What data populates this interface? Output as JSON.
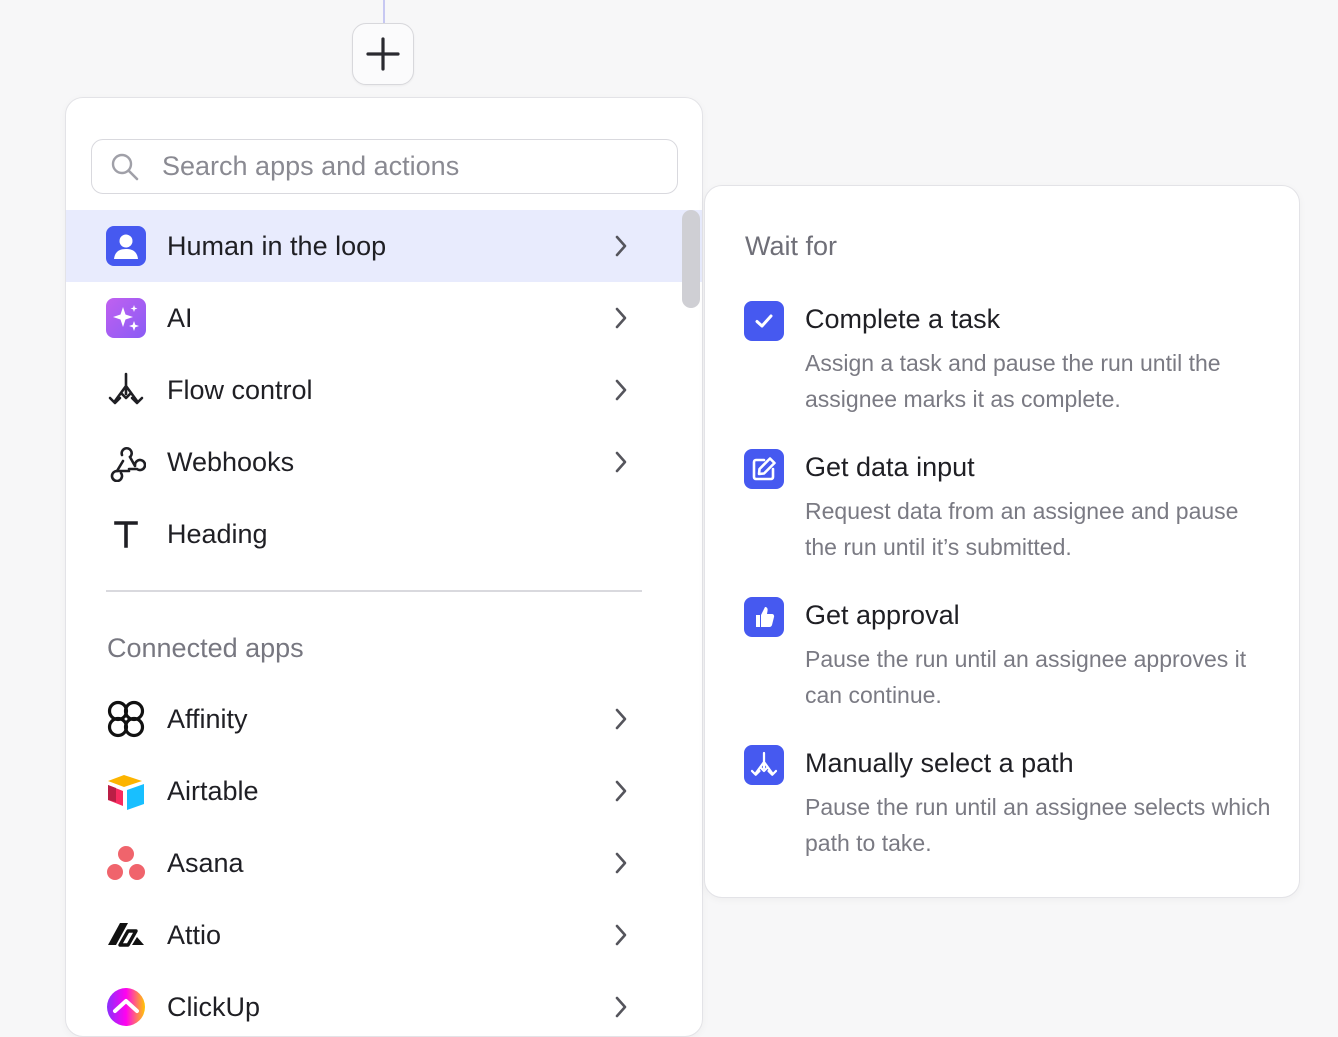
{
  "search": {
    "placeholder": "Search apps and actions"
  },
  "menu": {
    "items": [
      {
        "label": "Human in the loop",
        "icon": "person-icon",
        "active": true
      },
      {
        "label": "AI",
        "icon": "sparkles-icon"
      },
      {
        "label": "Flow control",
        "icon": "split-arrows-icon"
      },
      {
        "label": "Webhooks",
        "icon": "webhook-icon"
      },
      {
        "label": "Heading",
        "icon": "text-heading-icon"
      }
    ],
    "connected_label": "Connected apps",
    "apps": [
      {
        "label": "Affinity",
        "icon": "affinity-logo-icon"
      },
      {
        "label": "Airtable",
        "icon": "airtable-logo-icon"
      },
      {
        "label": "Asana",
        "icon": "asana-logo-icon"
      },
      {
        "label": "Attio",
        "icon": "attio-logo-icon"
      },
      {
        "label": "ClickUp",
        "icon": "clickup-logo-icon"
      }
    ]
  },
  "submenu": {
    "title": "Wait for",
    "options": [
      {
        "title": "Complete a task",
        "description": "Assign a task and pause the run until the assignee marks it as complete.",
        "icon": "checkbox-icon"
      },
      {
        "title": "Get data input",
        "description": "Request data from an assignee and pause the run until it’s submitted.",
        "icon": "edit-form-icon"
      },
      {
        "title": "Get approval",
        "description": "Pause the run until an assignee approves it can continue.",
        "icon": "thumbs-up-icon"
      },
      {
        "title": "Manually select a path",
        "description": "Pause the run until an assignee selects which path to take.",
        "icon": "split-path-icon"
      }
    ]
  },
  "colors": {
    "accent": "#4659f0",
    "active_row": "#e8ebfd",
    "ai": "#a25ff2"
  }
}
